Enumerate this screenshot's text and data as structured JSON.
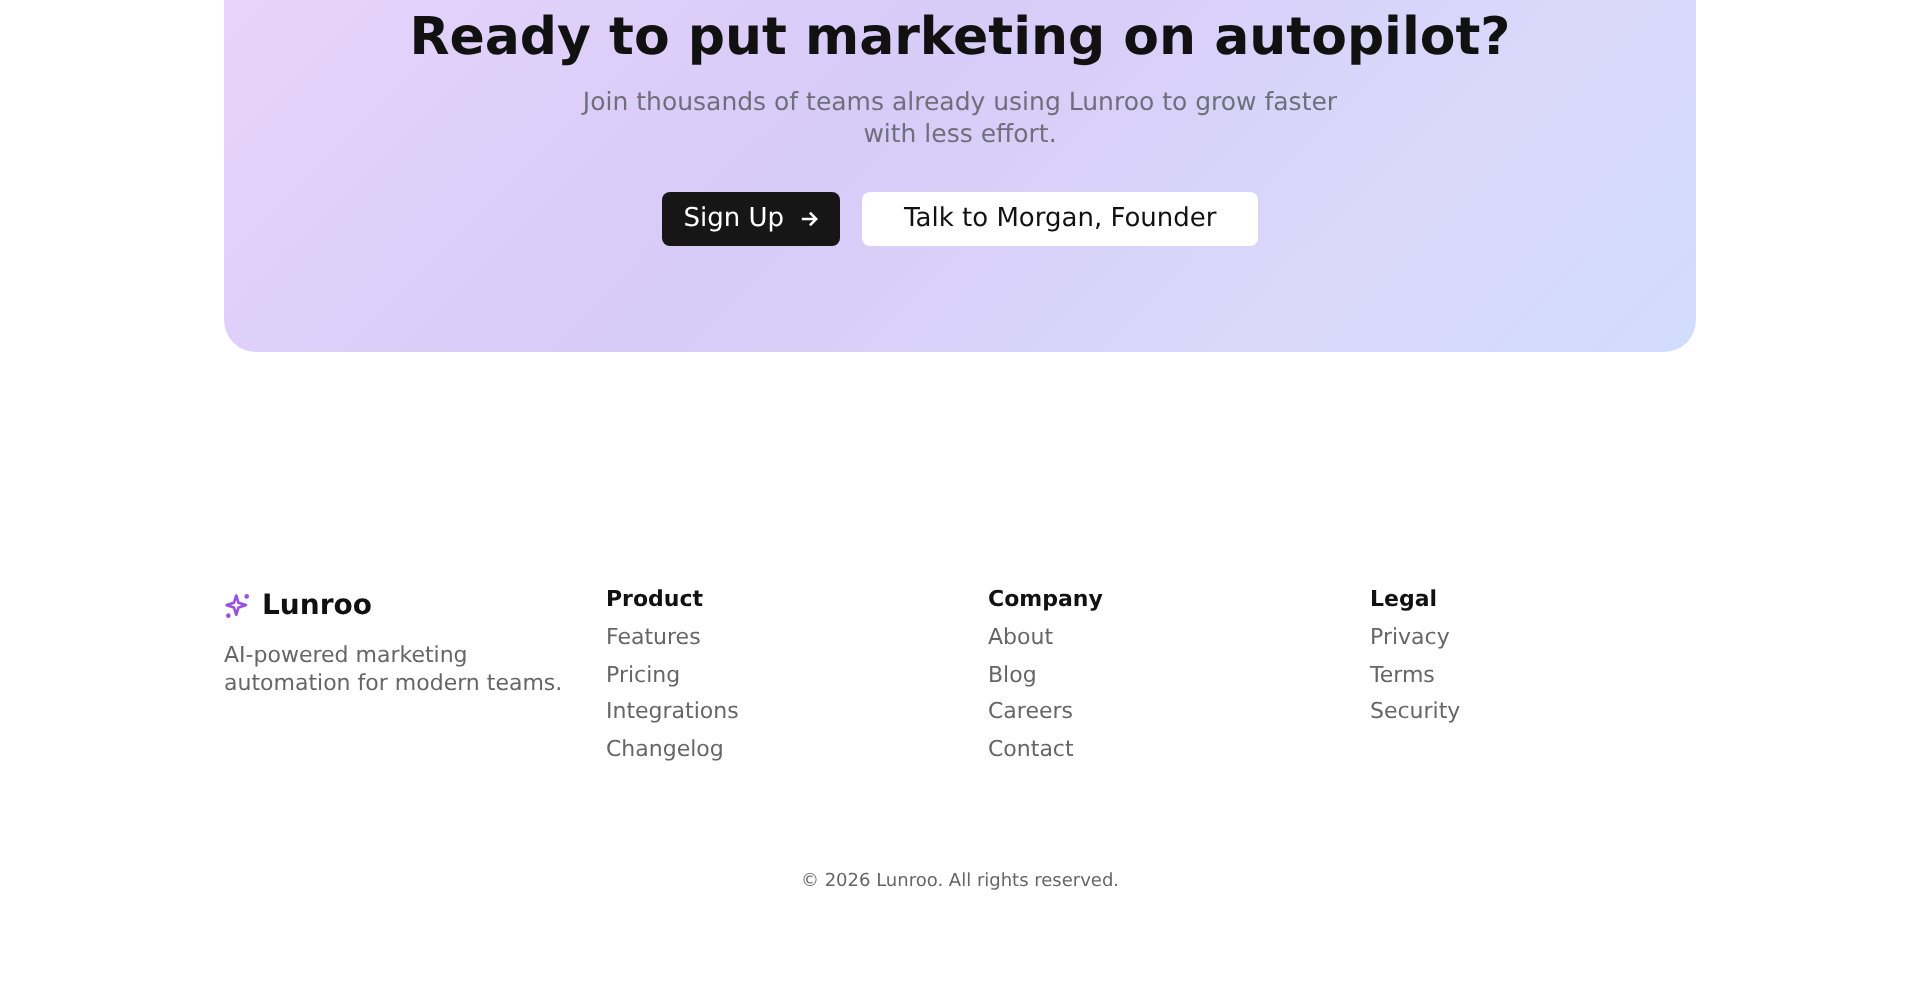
{
  "cta": {
    "title": "Ready to put marketing on autopilot?",
    "subtitle": "Join thousands of teams already using Lunroo to grow faster with less effort.",
    "buttons": [
      {
        "label": "Sign Up",
        "kind": "primary"
      },
      {
        "label": "Talk to Morgan, Founder",
        "kind": "secondary"
      }
    ]
  },
  "footer": {
    "brand": "Lunroo",
    "tagline": "AI-powered marketing automation for modern teams.",
    "columns": [
      {
        "heading": "Product",
        "links": [
          "Features",
          "Pricing",
          "Integrations",
          "Changelog"
        ]
      },
      {
        "heading": "Company",
        "links": [
          "About",
          "Blog",
          "Careers",
          "Contact"
        ]
      },
      {
        "heading": "Legal",
        "links": [
          "Privacy",
          "Terms",
          "Security"
        ]
      }
    ],
    "copyright": "© 2026 Lunroo. All rights reserved."
  }
}
